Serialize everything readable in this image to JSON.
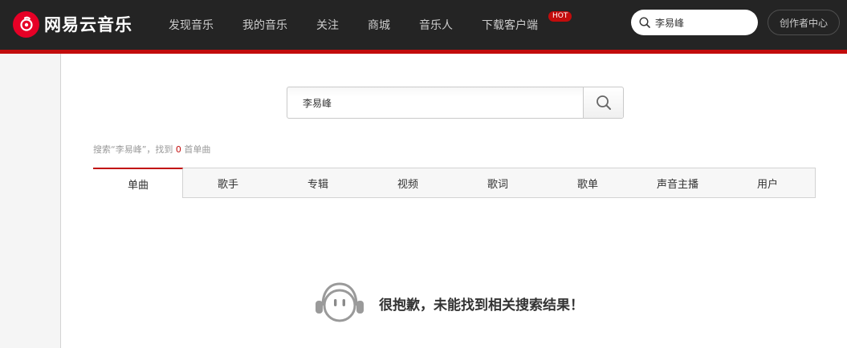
{
  "app": {
    "brand": "网易云音乐",
    "brand_color": "#c20c0c"
  },
  "nav": {
    "items": [
      {
        "label": "发现音乐"
      },
      {
        "label": "我的音乐"
      },
      {
        "label": "关注"
      },
      {
        "label": "商城"
      },
      {
        "label": "音乐人"
      },
      {
        "label": "下载客户端",
        "badge": "HOT"
      }
    ]
  },
  "top_search": {
    "value": "李易峰",
    "icon": "search-icon"
  },
  "creator_button": {
    "label": "创作者中心"
  },
  "search": {
    "value": "李易峰",
    "icon": "search-icon"
  },
  "result": {
    "prefix": "搜索“李易峰”，找到 ",
    "count": "0",
    "suffix": " 首单曲"
  },
  "tabs": [
    {
      "label": "单曲",
      "active": true
    },
    {
      "label": "歌手"
    },
    {
      "label": "专辑"
    },
    {
      "label": "视频"
    },
    {
      "label": "歌词"
    },
    {
      "label": "歌单"
    },
    {
      "label": "声音主播"
    },
    {
      "label": "用户"
    }
  ],
  "empty_state": {
    "message": "很抱歉，未能找到相关搜索结果！",
    "icon": "headphones-face-icon"
  }
}
